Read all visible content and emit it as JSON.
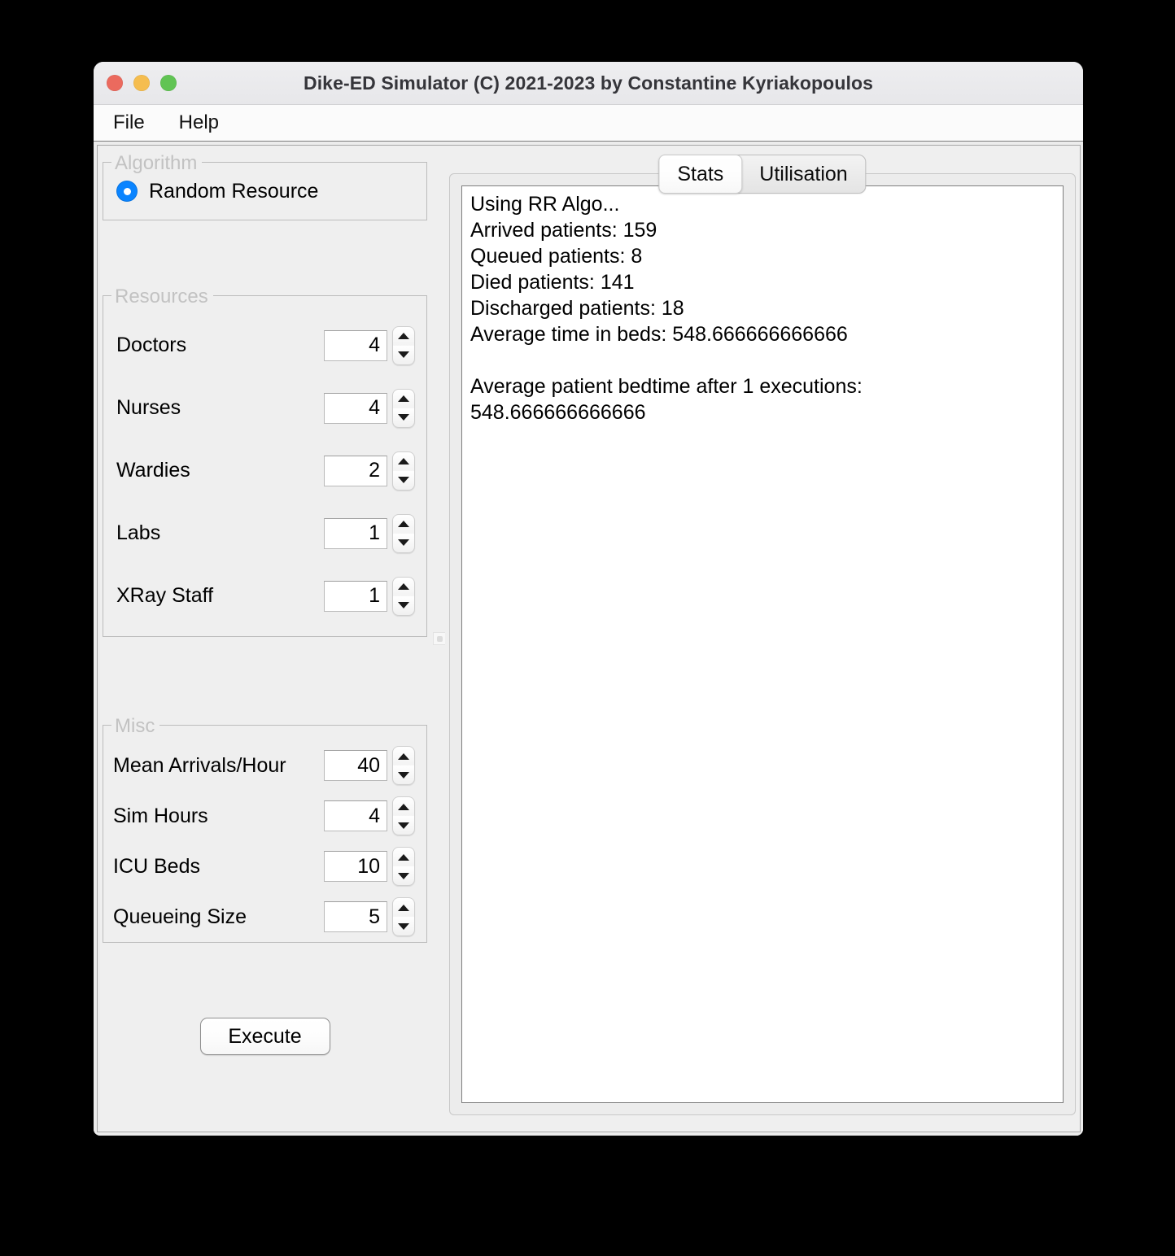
{
  "window": {
    "title": "Dike-ED Simulator (C) 2021-2023 by Constantine Kyriakopoulos",
    "traffic_lights": {
      "close": "close-button",
      "minimize": "minimize-button",
      "zoom": "zoom-button"
    },
    "colors": {
      "close": "#eb6a5e",
      "minimize": "#f5bd4f",
      "zoom": "#61c454",
      "accent": "#0a84ff",
      "window_bg": "#ececec",
      "panel_bg": "#efefef",
      "text": "#000000",
      "group_title": "#c2c2c2"
    }
  },
  "menubar": {
    "items": [
      {
        "label": "File"
      },
      {
        "label": "Help"
      }
    ]
  },
  "left": {
    "algorithm": {
      "title": "Algorithm",
      "options": [
        {
          "label": "Random Resource",
          "selected": true
        }
      ]
    },
    "resources": {
      "title": "Resources",
      "fields": [
        {
          "label": "Doctors",
          "value": "4"
        },
        {
          "label": "Nurses",
          "value": "4"
        },
        {
          "label": "Wardies",
          "value": "2"
        },
        {
          "label": "Labs",
          "value": "1"
        },
        {
          "label": "XRay Staff",
          "value": "1"
        }
      ]
    },
    "misc": {
      "title": "Misc",
      "fields": [
        {
          "label": "Mean Arrivals/Hour",
          "value": "40"
        },
        {
          "label": "Sim Hours",
          "value": "4"
        },
        {
          "label": "ICU Beds",
          "value": "10"
        },
        {
          "label": "Queueing Size",
          "value": "5"
        }
      ]
    },
    "execute_label": "Execute"
  },
  "right": {
    "tabs": [
      {
        "label": "Stats",
        "active": true
      },
      {
        "label": "Utilisation",
        "active": false
      }
    ],
    "stats_text": "Using RR Algo...\nArrived patients: 159\nQueued patients: 8\nDied patients: 141\nDischarged patients: 18\nAverage time in beds: 548.666666666666\n\nAverage patient bedtime after 1 executions:\n548.666666666666"
  }
}
